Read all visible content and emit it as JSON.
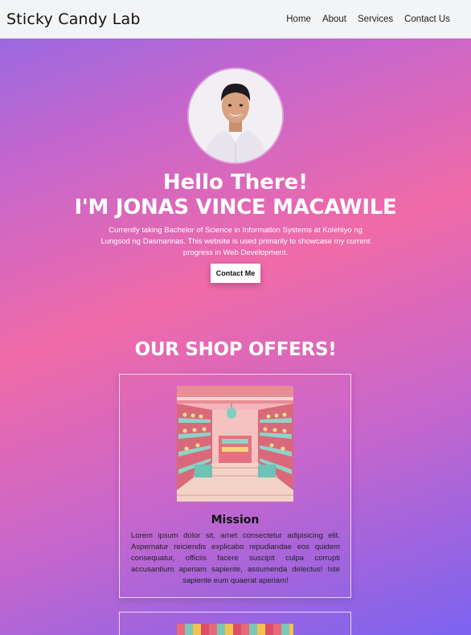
{
  "nav": {
    "brand": "Sticky Candy Lab",
    "links": [
      "Home",
      "About",
      "Services",
      "Contact Us"
    ]
  },
  "hero": {
    "greeting": "Hello There!",
    "name": "I'M JONAS VINCE MACAWILE",
    "bio": "Currently taking Bachelor of Science in Information Systems at Kolehiyo ng Lungsod ng Dasmarinas. This website is used primarily to showcase my current progress in Web Development.",
    "button": "Contact Me"
  },
  "offers": {
    "title": "OUR SHOP OFFERS!",
    "cards": [
      {
        "title": "Mission",
        "text": "Lorem ipsum dolor sit, amet consectetur adipisicing elit. Aspernatur reiciendis explicabo repudiandae eos quidem consequatur, officiis facere suscipit culpa corrupti accusantium aperiam sapiente, assumenda delectus! Iste sapiente eum quaerat aperiam!"
      }
    ]
  },
  "colors": {
    "nav_bg": "#f3f4f6",
    "gradient_purple": "#8f6ae6",
    "gradient_pink": "#f06aa8",
    "text_white": "#ffffff"
  }
}
